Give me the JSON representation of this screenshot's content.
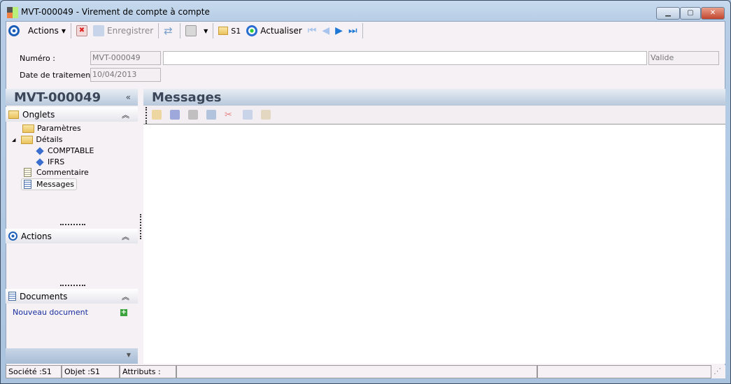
{
  "window": {
    "title": "MVT-000049 -  Virement de compte à compte",
    "minimize": "▁",
    "maximize": "▢",
    "close": "✕"
  },
  "toolbar": {
    "actions": "Actions",
    "save": "Enregistrer",
    "s1": "S1",
    "refresh": "Actualiser"
  },
  "form": {
    "numero_label": "Numéro :",
    "numero_value": "MVT-000049",
    "description_value": "",
    "status_value": "Valide",
    "date_label": "Date de traitement :",
    "date_value": "10/04/2013"
  },
  "left": {
    "title": "MVT-000049",
    "collapse": "«",
    "onglets": {
      "label": "Onglets",
      "items": [
        "Paramètres",
        "Détails",
        "COMPTABLE",
        "IFRS",
        "Commentaire",
        "Messages"
      ]
    },
    "actions": {
      "label": "Actions"
    },
    "documents": {
      "label": "Documents",
      "new_doc": "Nouveau document"
    },
    "chev": "⌃"
  },
  "main": {
    "title": "Messages"
  },
  "status": {
    "societe": "Société :S1",
    "objet": "Objet :S1",
    "attributs": "Attributs :",
    "c4": "",
    "c5": "",
    "c6": ""
  }
}
